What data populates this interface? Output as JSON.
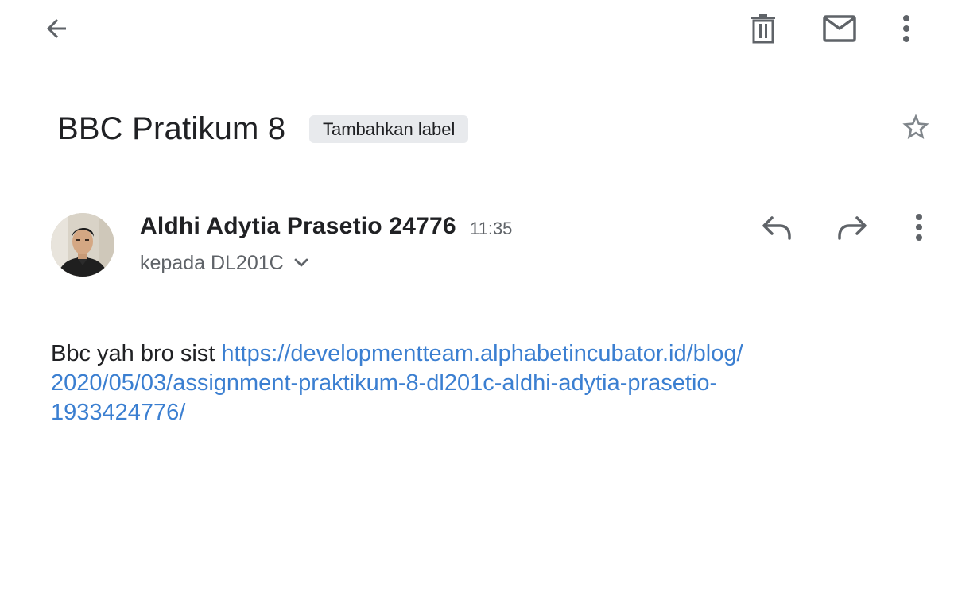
{
  "toolbar": {
    "back_icon": "arrow-back-icon",
    "delete_icon": "trash-icon",
    "mark_unread_icon": "mail-icon",
    "more_icon": "more-vertical-icon"
  },
  "email": {
    "subject": "BBC Pratikum 8",
    "label_chip": "Tambahkan label",
    "star_icon": "star-outline-icon",
    "sender": {
      "name": "Aldhi Adytia Prasetio 24776",
      "time": "11:35",
      "recipient": "kepada DL201C",
      "avatar": "sender-photo"
    },
    "actions": {
      "reply_icon": "reply-icon",
      "forward_icon": "forward-icon",
      "more_icon": "more-vertical-icon"
    },
    "body": {
      "text": "Bbc yah bro sist ",
      "link_line1": "https://developmentteam.alphabetincubator.id/blog/",
      "link_line2": "2020/05/03/assignment-praktikum-8-dl201c-aldhi-adytia-prasetio-",
      "link_line3": "1933424776/"
    }
  },
  "colors": {
    "icon_gray": "#5f6368",
    "link_blue": "#3b7fd1",
    "chip_bg": "#e8eaed",
    "text": "#202124"
  }
}
